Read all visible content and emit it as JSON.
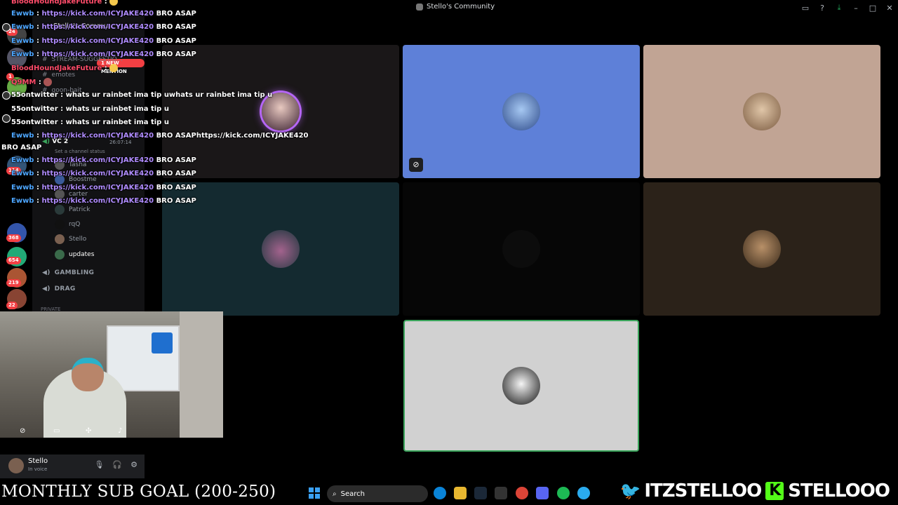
{
  "window": {
    "title": "Stello's Community",
    "controls": [
      "inbox-icon",
      "help-icon",
      "download-icon",
      "minimize",
      "maximize",
      "close"
    ]
  },
  "server_rail": {
    "badges": [
      "24",
      "1",
      "114",
      "368",
      "654",
      "219",
      "22"
    ]
  },
  "sidebar": {
    "server_name": "Stello's Commu...",
    "mention_pill": "1 NEW MENTION",
    "channels": [
      "STREAM-SUGGESTIO...",
      "emotes",
      "goon-bait"
    ],
    "voice_channel": {
      "name": "VC 2",
      "timer": "26:07:14",
      "status": "Set a channel status",
      "members": [
        "Tasha",
        "Boostme",
        "carter",
        "Patrick",
        "rqQ",
        "Stello",
        "updates"
      ]
    },
    "voice_categories": [
      "GAMBLING",
      "DRAG"
    ],
    "private_label": "PRIVATE"
  },
  "chat": {
    "messages": [
      {
        "user": "BloodHoundJakeFuture",
        "sep": ":",
        "link": "",
        "text": ""
      },
      {
        "user": "Ewwb",
        "sep": ":",
        "link": "https://kick.com/ICYJAKE420",
        "text": "BRO ASAP"
      },
      {
        "user": "Ewwb",
        "sep": ":",
        "link": "https://kick.com/ICYJAKE420",
        "text": "BRO ASAP"
      },
      {
        "user": "Ewwb",
        "sep": ":",
        "link": "https://kick.com/ICYJAKE420",
        "text": "BRO ASAP"
      },
      {
        "user": "Ewwb",
        "sep": ":",
        "link": "https://kick.com/ICYJAKE420",
        "text": "BRO ASAP"
      },
      {
        "user": "BloodHoundJakeFuture",
        "sep": ":",
        "link": "",
        "text": ""
      },
      {
        "user": "Q9MM",
        "sep": ":",
        "link": "",
        "text": ""
      },
      {
        "user": "55ontwitter",
        "sep": ":",
        "link": "",
        "text": "whats ur rainbet ima tip uwhats ur rainbet ima tip u"
      },
      {
        "user": "55ontwitter",
        "sep": ":",
        "link": "",
        "text": "whats ur rainbet ima tip u"
      },
      {
        "user": "55ontwitter",
        "sep": ":",
        "link": "",
        "text": "whats ur rainbet ima tip u"
      },
      {
        "user": "Ewwb",
        "sep": ":",
        "link": "https://kick.com/ICYJAKE420",
        "text": "BRO ASAPhttps://kick.com/ICYJAKE420"
      },
      {
        "user": "Ewwb",
        "sep": ":",
        "link": "https://kick.com/ICYJAKE420",
        "text": "BRO ASAP"
      },
      {
        "user": "Ewwb",
        "sep": ":",
        "link": "https://kick.com/ICYJAKE420",
        "text": "BRO ASAP"
      },
      {
        "user": "Ewwb",
        "sep": ":",
        "link": "https://kick.com/ICYJAKE420",
        "text": "BRO ASAP"
      },
      {
        "user": "Ewwb",
        "sep": ":",
        "link": "https://kick.com/ICYJAKE420",
        "text": "BRO ASAP"
      }
    ],
    "wrap_text": "BRO ASAP"
  },
  "video_tiles": [
    "tile-1",
    "tile-2-muted",
    "tile-3",
    "tile-4",
    "tile-5",
    "tile-6",
    "tile-7-speaking"
  ],
  "user_panel": {
    "name": "Stello",
    "status": "In voice"
  },
  "overlay": {
    "sub_goal": "MONTHLY SUB GOAL (200-250)",
    "twitter_handle": "ITZSTELLOO",
    "kick_handle": "STELLOOO",
    "kick_letter": "K"
  },
  "taskbar": {
    "search_label": "Search"
  },
  "colors": {
    "speaking_border": "#3ba55c",
    "mention": "#f23f43",
    "link": "#b08cff",
    "kick_green": "#53fc18",
    "twitter_blue": "#1da1f2"
  }
}
